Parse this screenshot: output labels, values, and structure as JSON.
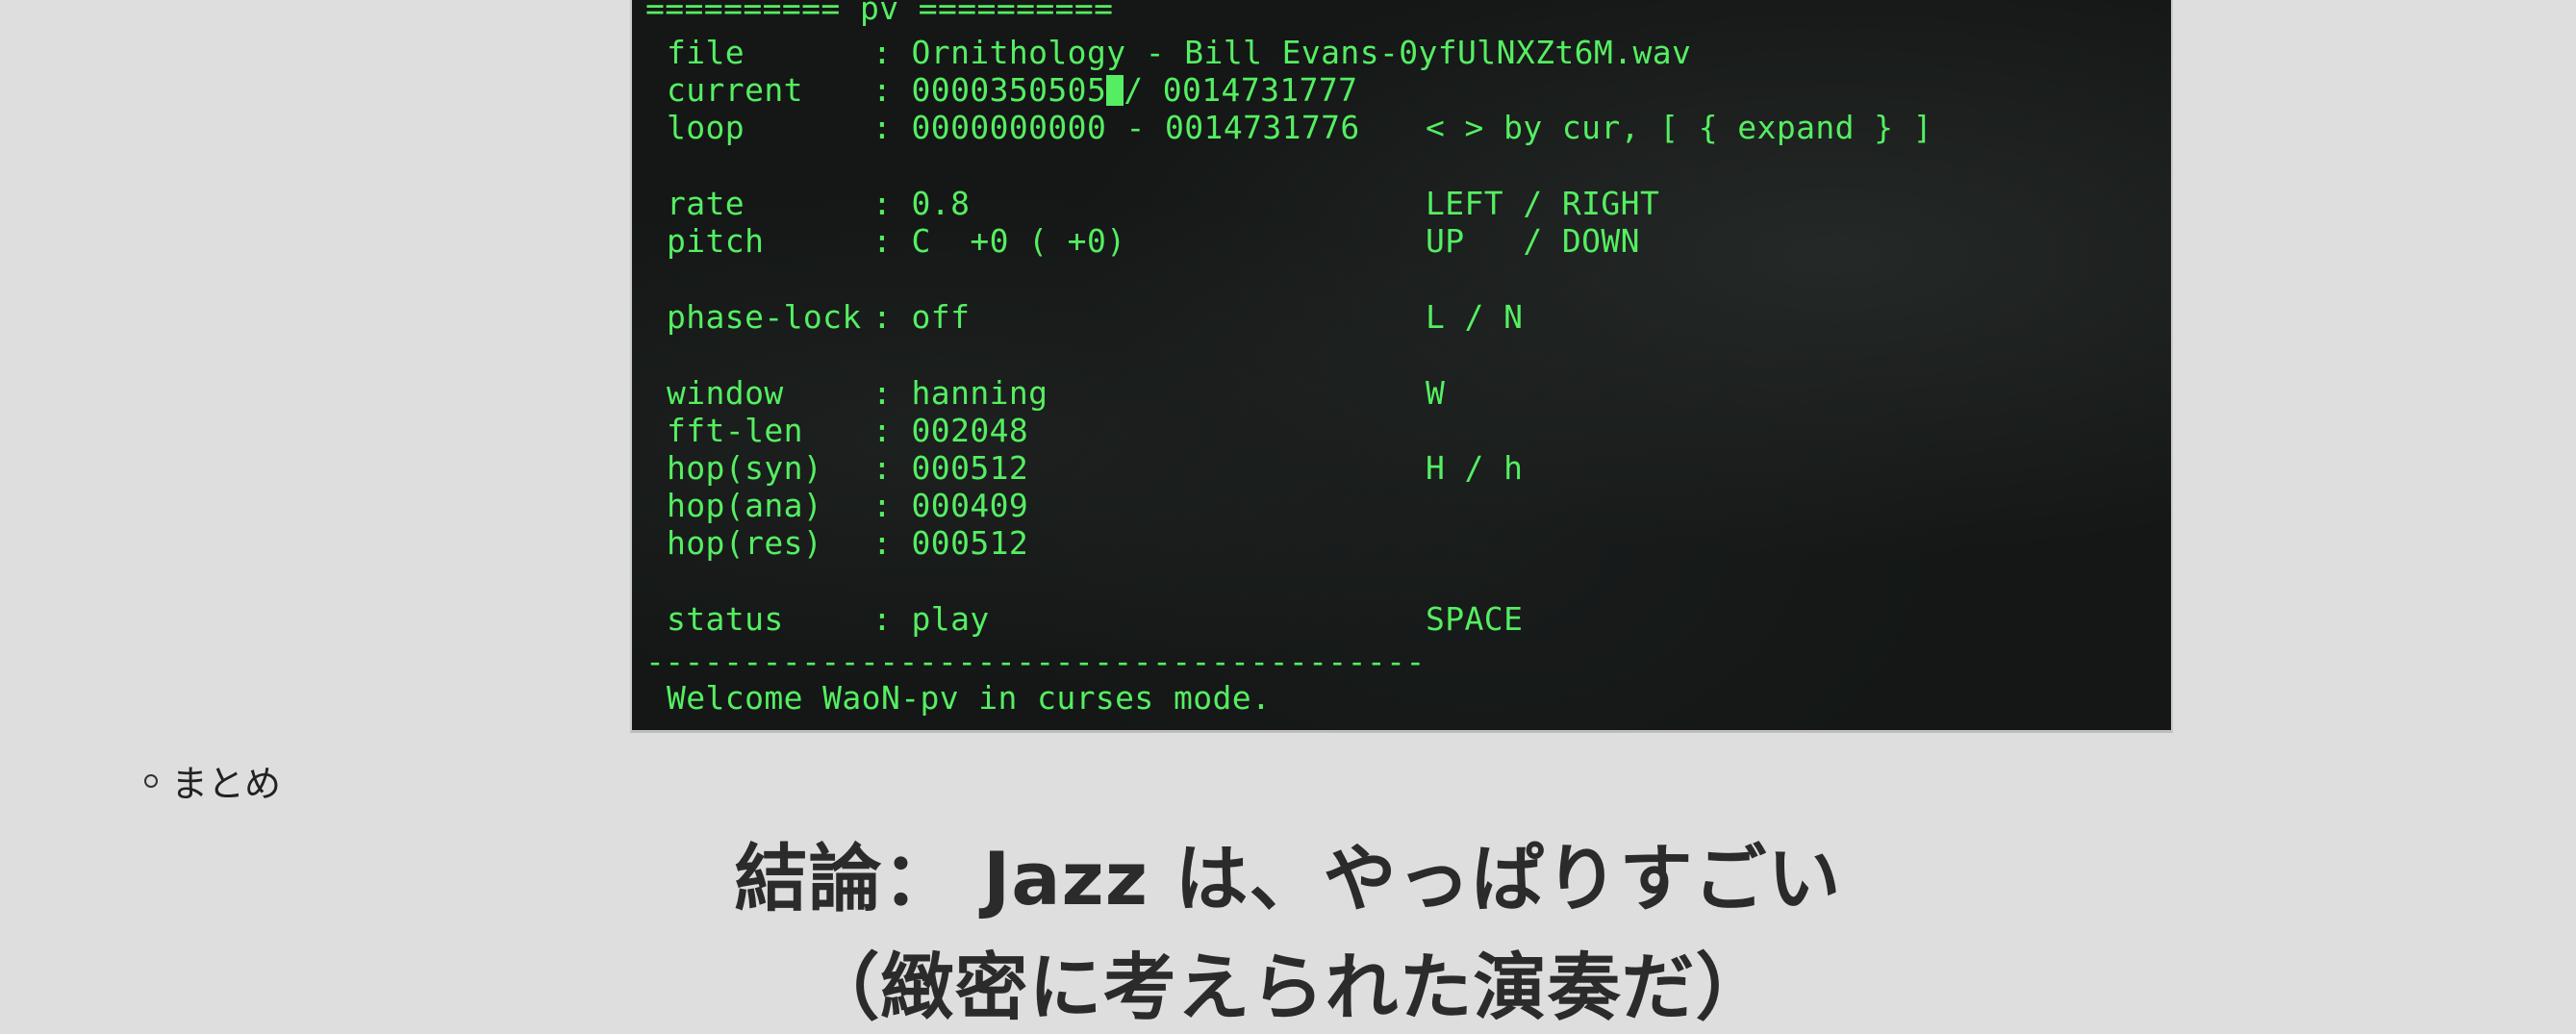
{
  "terminal": {
    "header": "========== pv ==========",
    "rows": {
      "file": {
        "label": "file",
        "value": ": Ornithology - Bill Evans-0yfUlNXZt6M.wav"
      },
      "current": {
        "label": "current",
        "value_before_cursor": ": 0000350505",
        "value_after_cursor": "/ 0014731777"
      },
      "loop": {
        "label": "loop",
        "value": ": 0000000000 - 0014731776",
        "hint": "< > by cur, [ { expand } ]"
      },
      "rate": {
        "label": "rate",
        "value": ": 0.8",
        "hint": "LEFT / RIGHT"
      },
      "pitch": {
        "label": "pitch",
        "value": ": C  +0 ( +0)",
        "hint": "UP   / DOWN"
      },
      "phase_lock": {
        "label": "phase-lock",
        "value": ": off",
        "hint": "L / N"
      },
      "window": {
        "label": "window",
        "value": ": hanning",
        "hint": "W"
      },
      "fft_len": {
        "label": "fft-len",
        "value": ": 002048"
      },
      "hop_syn": {
        "label": "hop(syn)",
        "value": ": 000512",
        "hint": "H / h"
      },
      "hop_ana": {
        "label": "hop(ana)",
        "value": ": 000409"
      },
      "hop_res": {
        "label": "hop(res)",
        "value": ": 000512"
      },
      "status": {
        "label": "status",
        "value": ": play",
        "hint": "SPACE"
      }
    },
    "separator": "----------------------------------------",
    "welcome": "Welcome WaoN-pv in curses mode.",
    "text_color": "#55ee62"
  },
  "bullet": {
    "text": "まとめ"
  },
  "conclusion": {
    "line1": "結論： Jazz は、やっぱりすごい",
    "line2": "（緻密に考えられた演奏だ）"
  }
}
